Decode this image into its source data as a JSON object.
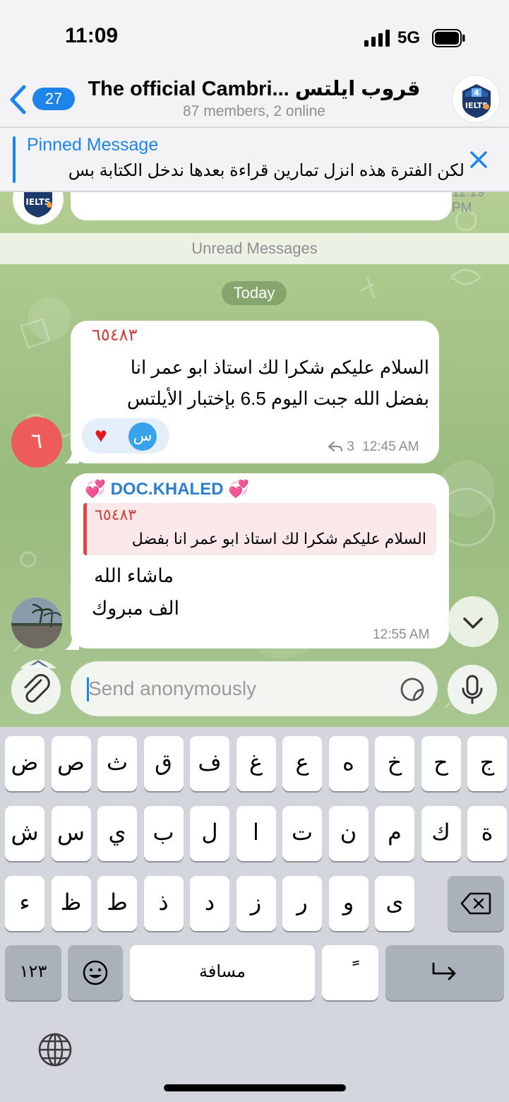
{
  "status_bar": {
    "time": "11:09",
    "network": "5G"
  },
  "header": {
    "back_badge": "27",
    "title": "The official Cambri... قروب ايلتس",
    "subtitle": "87 members, 2 online"
  },
  "pinned": {
    "title": "Pinned Message",
    "text": "لكن الفترة هذه انزل تمارين قراءة بعدها ندخل الكتابة بس"
  },
  "chat": {
    "previous_time": "11:19 PM",
    "unread_divider": "Unread Messages",
    "date_label": "Today",
    "messages": [
      {
        "sender": "٦٥٤٨٣",
        "text": "السلام عليكم   شكرا لك استاذ ابو عمر انا بفضل الله جبت اليوم 6.5 بإختبار الأيلتس",
        "reaction_heart": "♥",
        "reaction_user": "س",
        "reply_count": "3",
        "time": "12:45 AM",
        "avatar_letter": "٦"
      },
      {
        "sender": "DOC.KHALED",
        "sender_emoji_left": "💞",
        "sender_emoji_right": "💞",
        "reply_to_name": "٦٥٤٨٣",
        "reply_to_text": "السلام عليكم شكرا لك استاذ ابو عمر انا بفضل",
        "line1": "ماشاء الله",
        "line2": "الف مبروك",
        "time": "12:55 AM"
      }
    ]
  },
  "composer": {
    "placeholder": "Send anonymously"
  },
  "keyboard": {
    "row1": [
      "ض",
      "ص",
      "ث",
      "ق",
      "ف",
      "غ",
      "ع",
      "ه",
      "خ",
      "ح",
      "ج"
    ],
    "row2": [
      "ش",
      "س",
      "ي",
      "ب",
      "ل",
      "ا",
      "ت",
      "ن",
      "م",
      "ك",
      "ة"
    ],
    "row3": [
      "ء",
      "ظ",
      "ط",
      "ذ",
      "د",
      "ز",
      "ر",
      "و",
      "ى"
    ],
    "numbers_key": "١٢٣",
    "space_key": "مسافة",
    "diacritic_key": "ً",
    "icons": [
      "backspace-icon",
      "emoji-icon",
      "return-icon",
      "globe-icon"
    ]
  },
  "colors": {
    "accent": "#1f84ea",
    "sender_red": "#d0413e",
    "sender_blue": "#2b7fcf",
    "chat_bg": "#a9c58c"
  }
}
